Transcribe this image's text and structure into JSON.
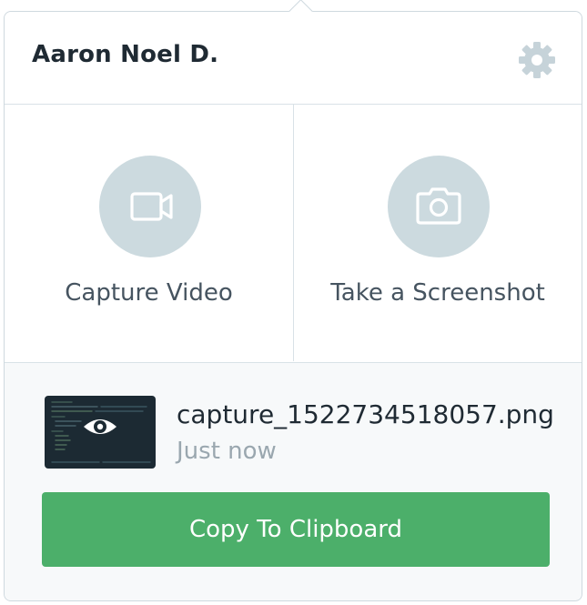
{
  "header": {
    "user_name": "Aaron Noel D.",
    "settings_icon": "gear-icon"
  },
  "actions": [
    {
      "label": "Capture Video",
      "icon": "video-camera-icon"
    },
    {
      "label": "Take a Screenshot",
      "icon": "camera-icon"
    }
  ],
  "recent_capture": {
    "file_name": "capture_1522734518057.png",
    "time": "Just now",
    "thumbnail_icon": "eye-icon"
  },
  "copy_button": {
    "label": "Copy To Clipboard"
  },
  "colors": {
    "accent_green": "#4caf6a",
    "icon_circle": "#ccdadf",
    "border": "#cfd9df",
    "footer_bg": "#f7f9fa"
  }
}
